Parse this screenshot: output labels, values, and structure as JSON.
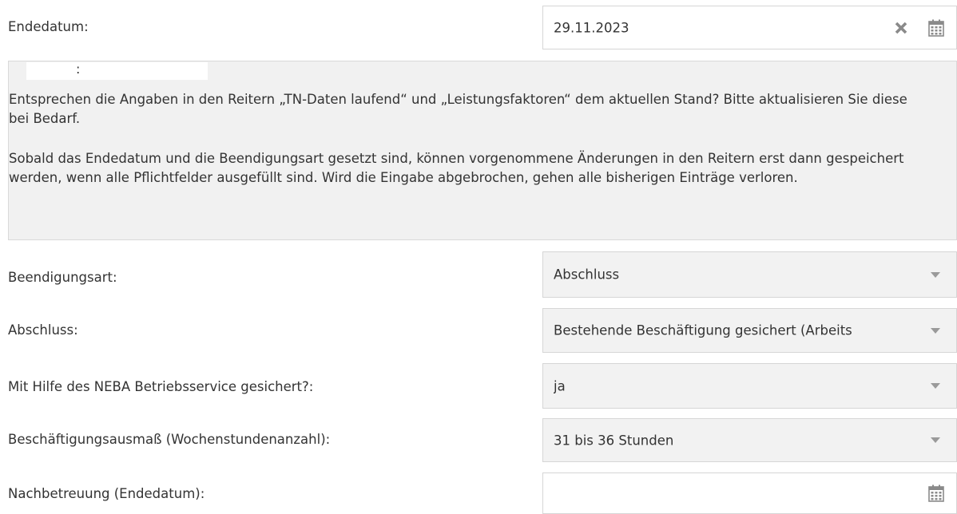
{
  "end_date": {
    "label": "Endedatum:",
    "value": "29.11.2023",
    "clear_icon": "times-icon",
    "calendar_icon": "calendar-icon"
  },
  "notice": {
    "heading_suffix": ":",
    "paragraph1": "Entsprechen die Angaben in den Reitern „TN-Daten laufend“ und „Leistungsfaktoren“ dem aktuellen Stand? Bitte aktualisieren Sie diese bei Bedarf.",
    "paragraph2": "Sobald das Endedatum und die Beendigungsart gesetzt sind, können vorgenommene Änderungen in den Reitern erst dann gespeichert werden, wenn alle Pflichtfelder ausgefüllt sind. Wird die Eingabe abgebrochen, gehen alle bisherigen Einträge verloren."
  },
  "fields": {
    "termination_type": {
      "label": "Beendigungsart:",
      "value": "Abschluss"
    },
    "completion": {
      "label": "Abschluss:",
      "value": "Bestehende Beschäftigung gesichert (Arbeits"
    },
    "neba": {
      "label": "Mit Hilfe des NEBA Betriebsservice gesichert?:",
      "value": "ja"
    },
    "employment_extent": {
      "label": "Beschäftigungsausmaß (Wochenstundenanzahl):",
      "value": "31 bis 36 Stunden"
    },
    "aftercare": {
      "label": "Nachbetreuung (Endedatum):",
      "value": ""
    }
  },
  "colors": {
    "select_background": "#f2f2f2",
    "notice_background": "#f1f1f1",
    "border": "#d6d6d6",
    "text": "#333333",
    "icon": "#8a8a8a"
  }
}
